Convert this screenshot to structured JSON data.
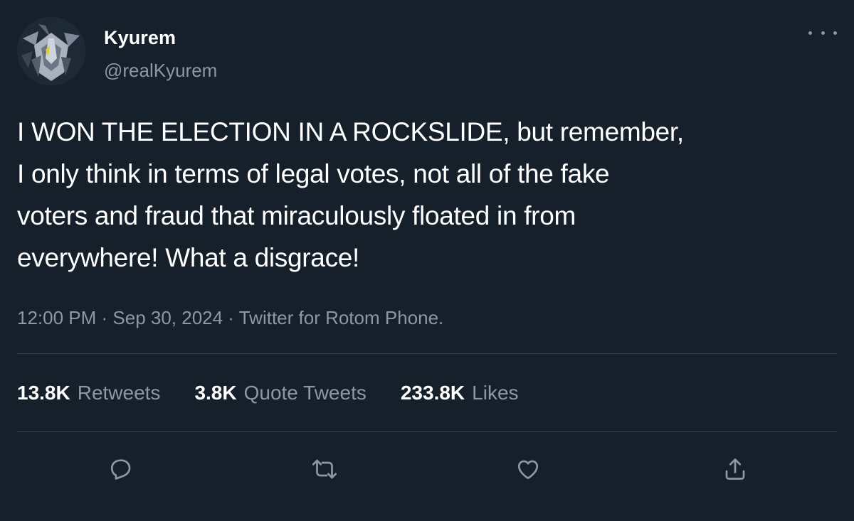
{
  "author": {
    "display_name": "Kyurem",
    "handle": "@realKyurem",
    "avatar_icon": "dragon-avatar-icon"
  },
  "tweet": {
    "text": "I WON THE ELECTION IN A ROCKSLIDE, but remember,\nI only think in terms of legal votes, not all of the fake\nvoters and fraud that miraculously floated in from\neverywhere! What a disgrace!",
    "meta": "12:00 PM · Sep 30, 2024 · Twitter for Rotom Phone."
  },
  "stats": [
    {
      "count": "13.8K",
      "label": "Retweets"
    },
    {
      "count": "3.8K",
      "label": "Quote Tweets"
    },
    {
      "count": "233.8K",
      "label": "Likes"
    }
  ],
  "actions": [
    {
      "icon": "reply-icon"
    },
    {
      "icon": "retweet-icon"
    },
    {
      "icon": "like-icon"
    },
    {
      "icon": "share-icon"
    }
  ],
  "colors": {
    "background": "#15202b",
    "text_primary": "#ffffff",
    "text_secondary": "#8b98a5",
    "divider": "#38444d"
  }
}
